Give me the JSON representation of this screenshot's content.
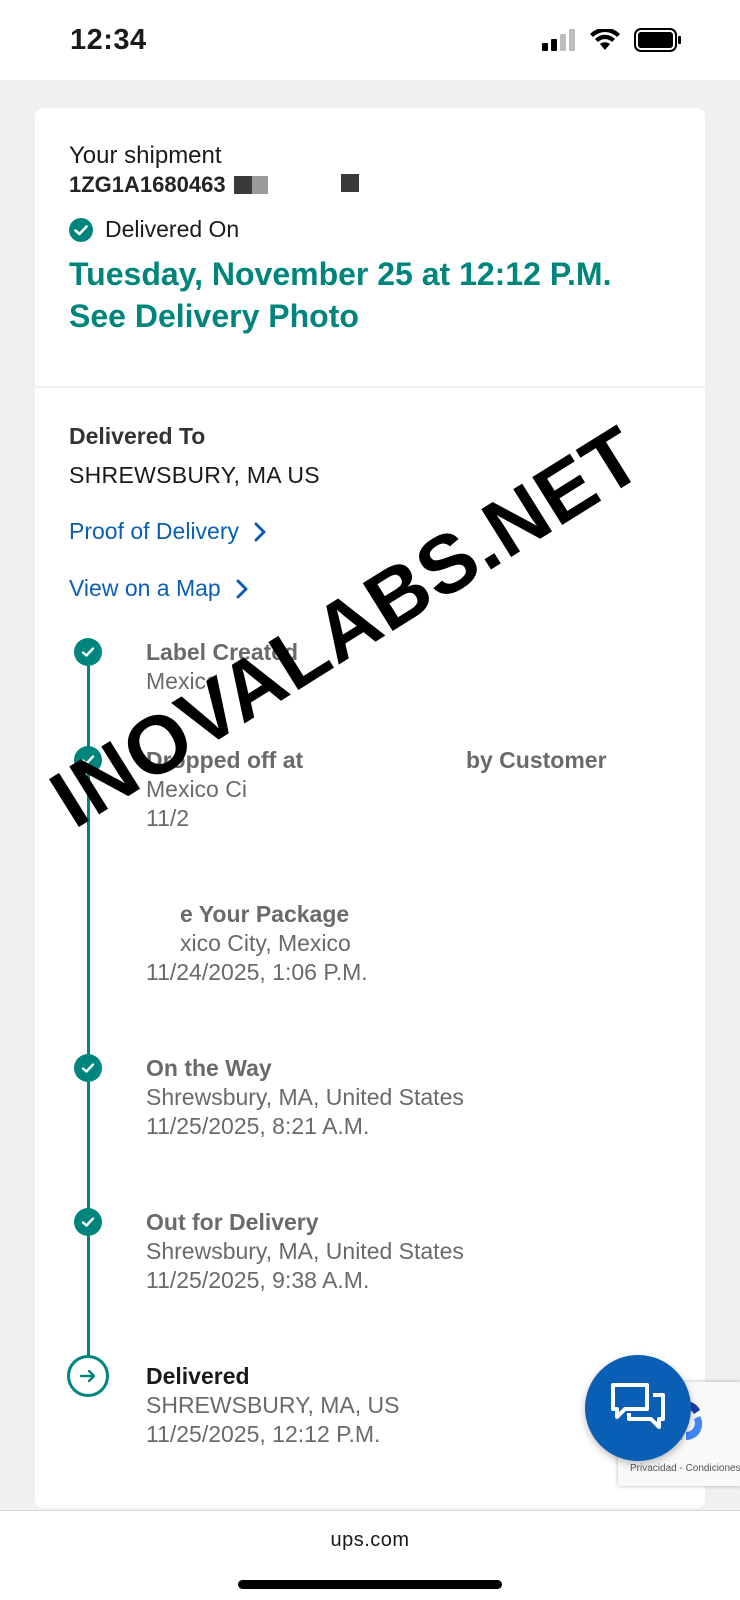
{
  "status_bar": {
    "time": "12:34"
  },
  "shipment": {
    "label": "Your shipment",
    "tracking_number": "1ZG1A1680463"
  },
  "delivery": {
    "status_label": "Delivered On",
    "date_text": "Tuesday, November 25 at 12:12 P.M.",
    "photo_link": "See Delivery Photo"
  },
  "delivered_to": {
    "label": "Delivered To",
    "value": "SHREWSBURY, MA US"
  },
  "links": {
    "proof": "Proof of Delivery",
    "map": "View on a Map"
  },
  "timeline": [
    {
      "title": "Label Created",
      "lines": [
        "Mexico"
      ]
    },
    {
      "title": "Dropped off at",
      "title_end": "by Customer",
      "lines": [
        "Mexico Ci",
        "11/2"
      ]
    },
    {
      "title": "e Your Package",
      "lines": [
        "xico City, Mexico",
        "11/24/2025, 1:06 P.M."
      ]
    },
    {
      "title": "On the Way",
      "lines": [
        "Shrewsbury, MA, United States",
        "11/25/2025, 8:21 A.M."
      ]
    },
    {
      "title": "Out for Delivery",
      "lines": [
        "Shrewsbury, MA, United States",
        "11/25/2025, 9:38 A.M."
      ]
    },
    {
      "title": "Delivered",
      "lines": [
        "SHREWSBURY, MA, US",
        "11/25/2025, 12:12 P.M."
      ]
    }
  ],
  "watermark": "INOVALABS.NET",
  "recaptcha": "Privacidad - Condiciones",
  "browser": {
    "url": "ups.com"
  },
  "colors": {
    "accent": "#00857d",
    "link": "#0a5fb4"
  }
}
